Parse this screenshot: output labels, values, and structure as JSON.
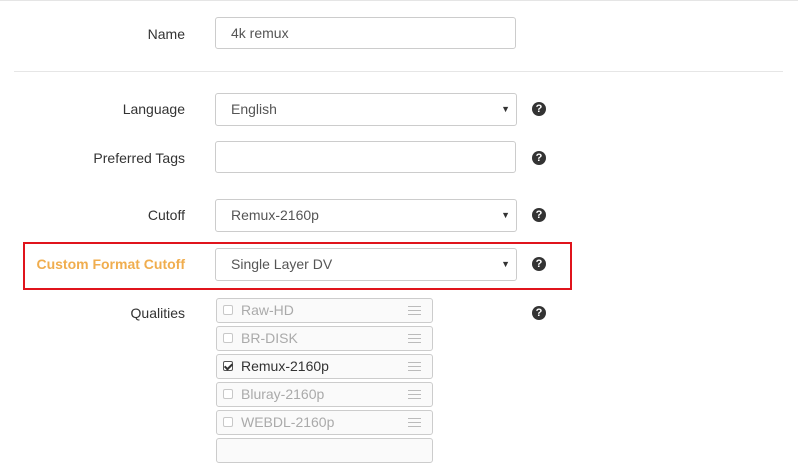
{
  "form": {
    "name": {
      "label": "Name",
      "value": "4k remux"
    },
    "language": {
      "label": "Language",
      "value": "English"
    },
    "preferred_tags": {
      "label": "Preferred Tags",
      "value": ""
    },
    "cutoff": {
      "label": "Cutoff",
      "value": "Remux-2160p"
    },
    "custom_format_cutoff": {
      "label": "Custom Format Cutoff",
      "value": "Single Layer DV"
    },
    "qualities": {
      "label": "Qualities",
      "items": [
        {
          "name": "Raw-HD",
          "checked": false
        },
        {
          "name": "BR-DISK",
          "checked": false
        },
        {
          "name": "Remux-2160p",
          "checked": true
        },
        {
          "name": "Bluray-2160p",
          "checked": false
        },
        {
          "name": "WEBDL-2160p",
          "checked": false
        }
      ]
    }
  },
  "help_icon": "question-circle-icon",
  "colors": {
    "warning_label": "#f0ad4e",
    "highlight_border": "#e0141c"
  }
}
